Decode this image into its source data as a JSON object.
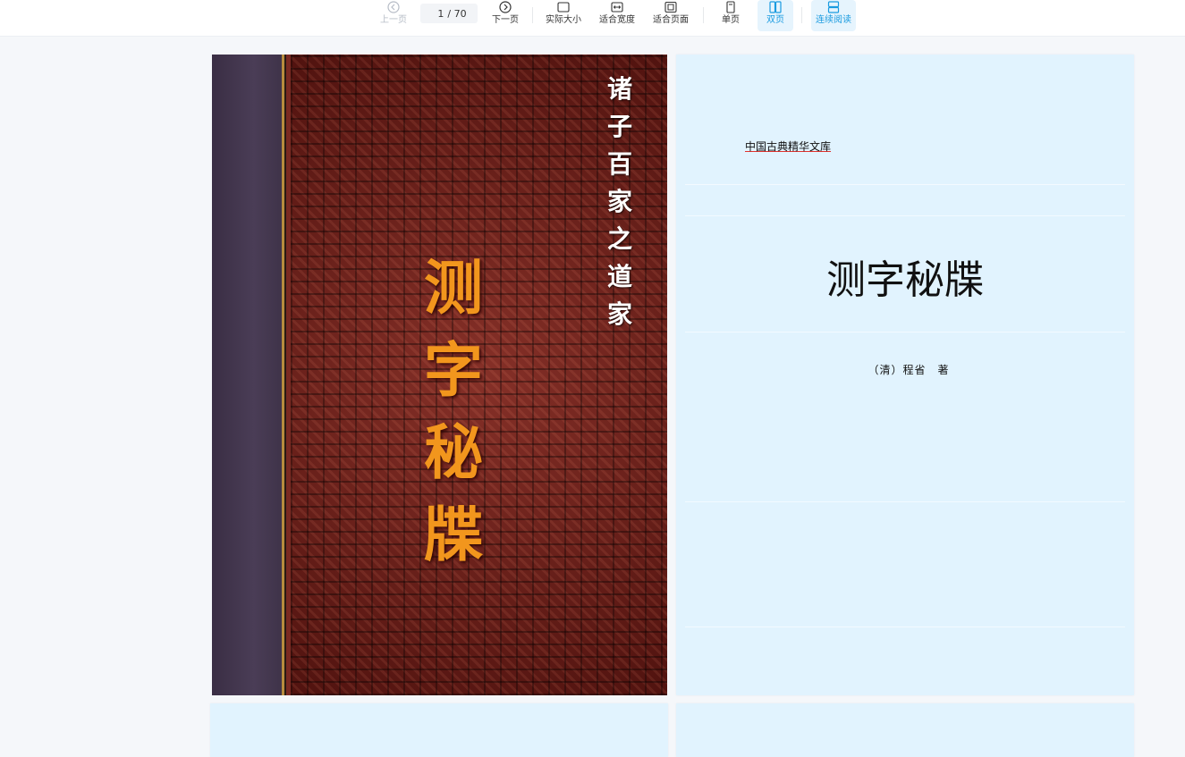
{
  "toolbar": {
    "prev_label": "上一页",
    "current_page": "1",
    "total_pages": "/ 70",
    "next_label": "下一页",
    "actual_size_label": "实际大小",
    "actual_size_icon_text": "1:1",
    "fit_width_label": "适合宽度",
    "fit_page_label": "适合页面",
    "single_label": "单页",
    "double_label": "双页",
    "continuous_label": "连续阅读"
  },
  "cover": {
    "series_text": "诸子百家之道家",
    "title_text": "测字秘牒"
  },
  "title_page": {
    "series": "中国古典精华文库",
    "title": "测字秘牒",
    "author": "（清）程省　著"
  },
  "colors": {
    "accent": "#1a9be0",
    "page_bg": "#e1f3fe",
    "cover_red": "#6e1f19",
    "cover_title": "#f2961d"
  }
}
